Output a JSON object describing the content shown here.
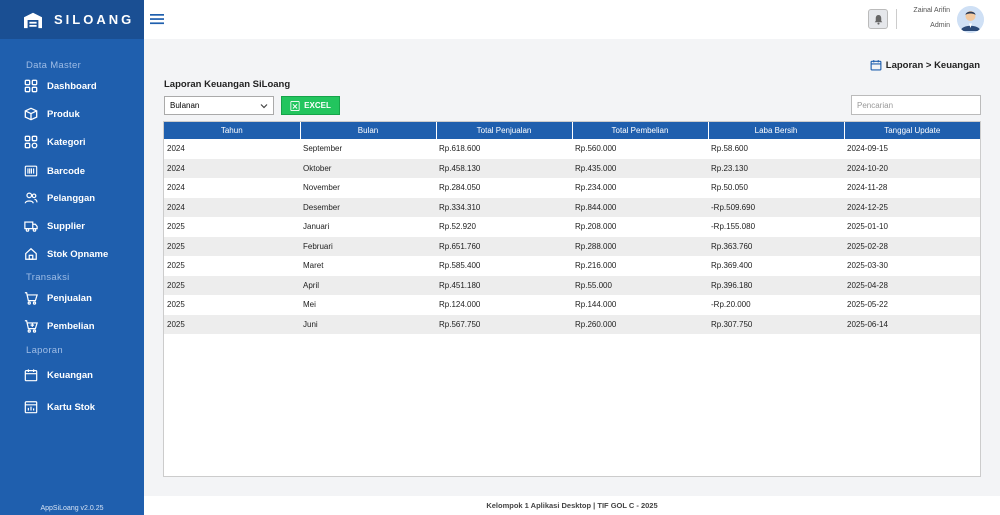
{
  "app": {
    "name": "SILOANG",
    "version": "AppSiLoang v2.0.25"
  },
  "sidebar": {
    "sections": {
      "data_master": "Data Master",
      "transaksi": "Transaksi",
      "laporan": "Laporan"
    },
    "items": {
      "dashboard": "Dashboard",
      "produk": "Produk",
      "kategori": "Kategori",
      "barcode": "Barcode",
      "pelanggan": "Pelanggan",
      "supplier": "Supplier",
      "stok_opname": "Stok Opname",
      "penjualan": "Penjualan",
      "pembelian": "Pembelian",
      "keuangan": "Keuangan",
      "kartu_stok": "Kartu Stok"
    }
  },
  "user": {
    "name": "Zainal Arifin",
    "role": "Admin"
  },
  "breadcrumb": "Laporan > Keuangan",
  "page_title": "Laporan Keuangan SiLoang",
  "filter": {
    "selected": "Bulanan"
  },
  "excel_label": "EXCEL",
  "search": {
    "placeholder": "Pencarian"
  },
  "table": {
    "headers": [
      "Tahun",
      "Bulan",
      "Total Penjualan",
      "Total Pembelian",
      "Laba Bersih",
      "Tanggal Update"
    ],
    "rows": [
      [
        "2024",
        "September",
        "Rp.618.600",
        "Rp.560.000",
        "Rp.58.600",
        "2024-09-15"
      ],
      [
        "2024",
        "Oktober",
        "Rp.458.130",
        "Rp.435.000",
        "Rp.23.130",
        "2024-10-20"
      ],
      [
        "2024",
        "November",
        "Rp.284.050",
        "Rp.234.000",
        "Rp.50.050",
        "2024-11-28"
      ],
      [
        "2024",
        "Desember",
        "Rp.334.310",
        "Rp.844.000",
        "-Rp.509.690",
        "2024-12-25"
      ],
      [
        "2025",
        "Januari",
        "Rp.52.920",
        "Rp.208.000",
        "-Rp.155.080",
        "2025-01-10"
      ],
      [
        "2025",
        "Februari",
        "Rp.651.760",
        "Rp.288.000",
        "Rp.363.760",
        "2025-02-28"
      ],
      [
        "2025",
        "Maret",
        "Rp.585.400",
        "Rp.216.000",
        "Rp.369.400",
        "2025-03-30"
      ],
      [
        "2025",
        "April",
        "Rp.451.180",
        "Rp.55.000",
        "Rp.396.180",
        "2025-04-28"
      ],
      [
        "2025",
        "Mei",
        "Rp.124.000",
        "Rp.144.000",
        "-Rp.20.000",
        "2025-05-22"
      ],
      [
        "2025",
        "Juni",
        "Rp.567.750",
        "Rp.260.000",
        "Rp.307.750",
        "2025-06-14"
      ]
    ]
  },
  "footer": "Kelompok 1 Aplikasi Desktop | TIF GOL C - 2025",
  "colors": {
    "sidebar": "#1f5fae",
    "sidebar_header": "#1a4f93",
    "table_header": "#1f5fae",
    "excel": "#22c55e"
  }
}
